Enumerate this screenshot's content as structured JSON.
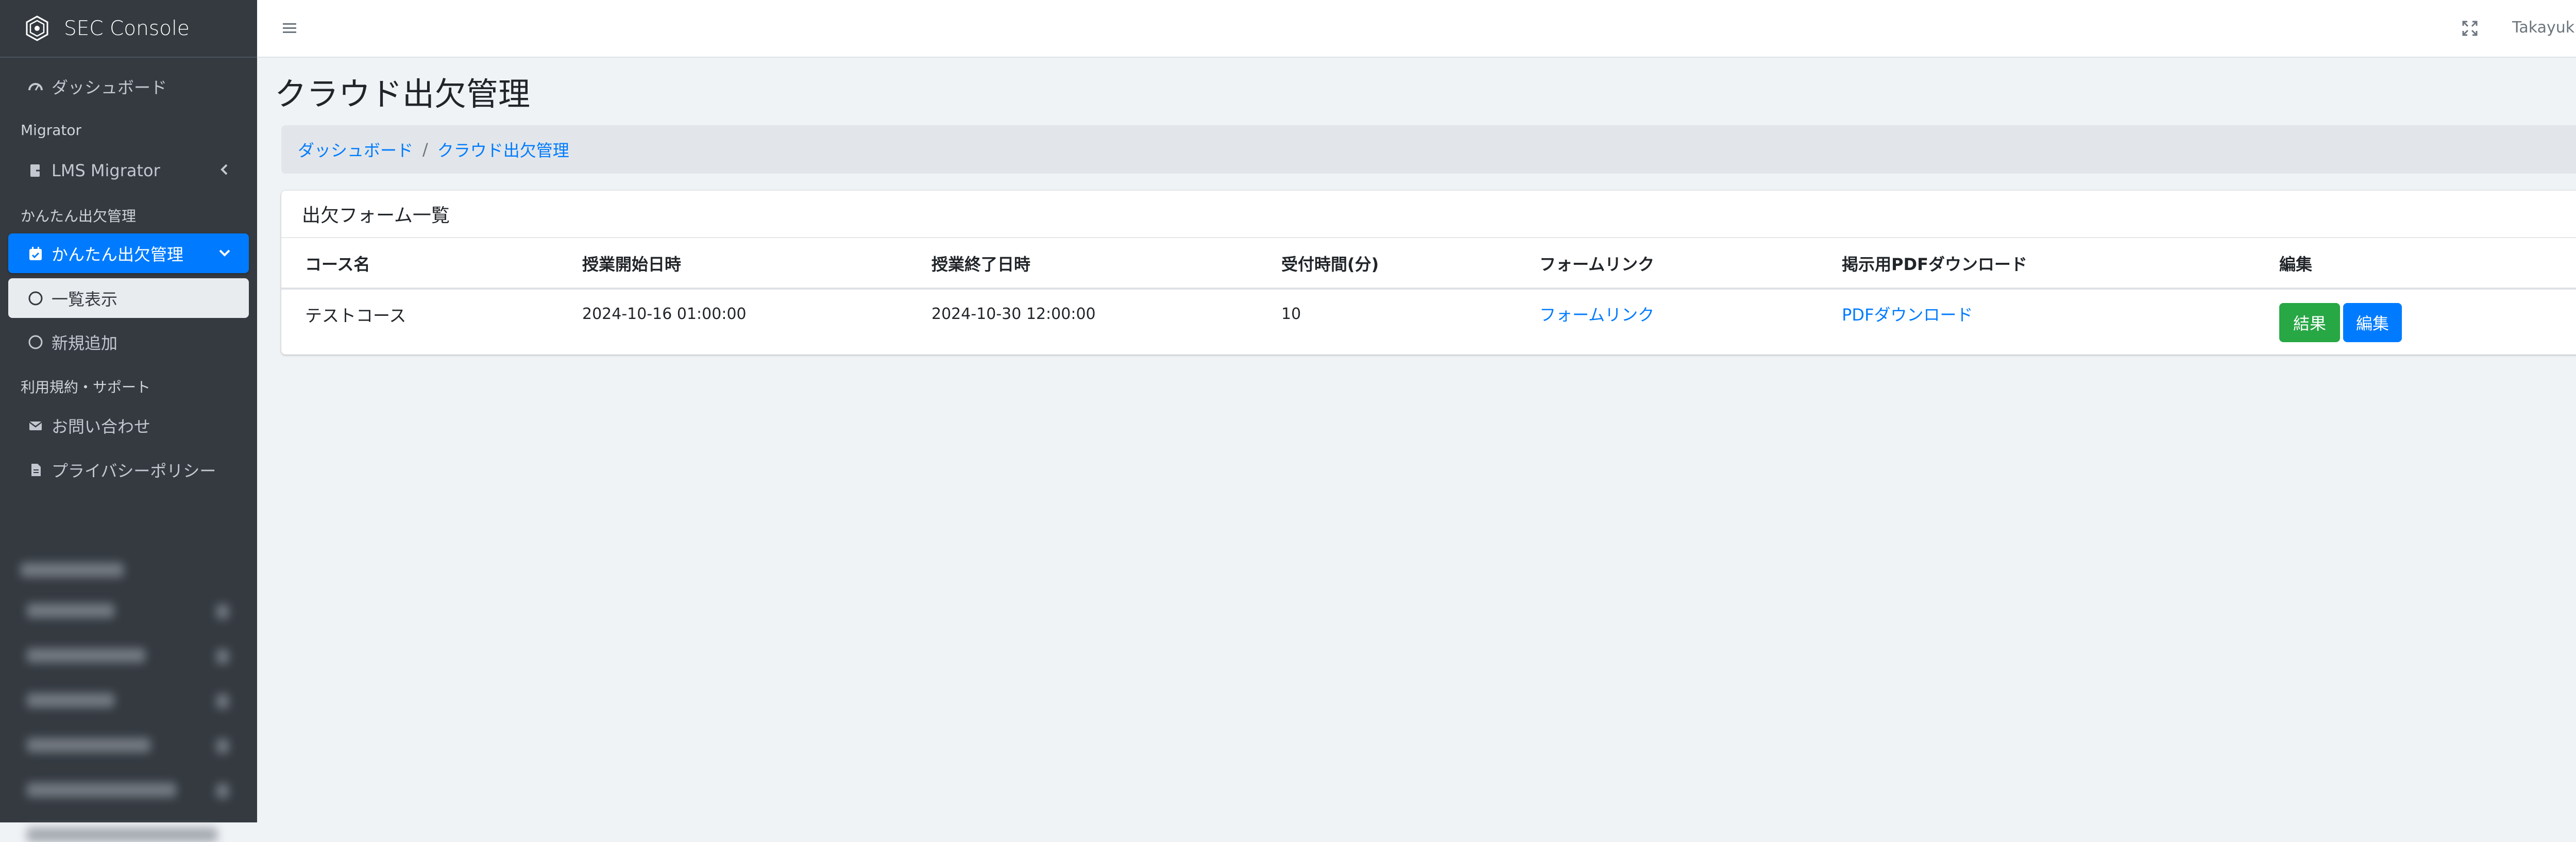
{
  "app": {
    "title": "SEC Console"
  },
  "sidebar": {
    "dashboard": "ダッシュボード",
    "header_migrator": "Migrator",
    "lms_migrator": "LMS Migrator",
    "header_attendance": "かんたん出欠管理",
    "attendance": "かんたん出欠管理",
    "list_view": "一覧表示",
    "add_new": "新規追加",
    "header_terms": "利用規約・サポート",
    "contact": "お問い合わせ",
    "privacy": "プライバシーポリシー"
  },
  "topbar": {
    "user": "Takayuki Fuwa"
  },
  "page": {
    "title": "クラウド出欠管理"
  },
  "breadcrumb": {
    "items": [
      "ダッシュボード",
      "クラウド出欠管理"
    ],
    "separator": "/"
  },
  "card": {
    "title": "出欠フォーム一覧",
    "columns": [
      "コース名",
      "授業開始日時",
      "授業終了日時",
      "受付時間(分)",
      "フォームリンク",
      "掲示用PDFダウンロード",
      "編集"
    ],
    "rows": [
      {
        "course": "テストコース",
        "start": "2024-10-16 01:00:00",
        "end": "2024-10-30 12:00:00",
        "minutes": "10",
        "form_link": "フォームリンク",
        "pdf": "PDFダウンロード",
        "result_btn": "結果",
        "edit_btn": "編集"
      }
    ]
  },
  "colors": {
    "primary": "#007bff",
    "success": "#28a745",
    "sidebar": "#343a40"
  }
}
